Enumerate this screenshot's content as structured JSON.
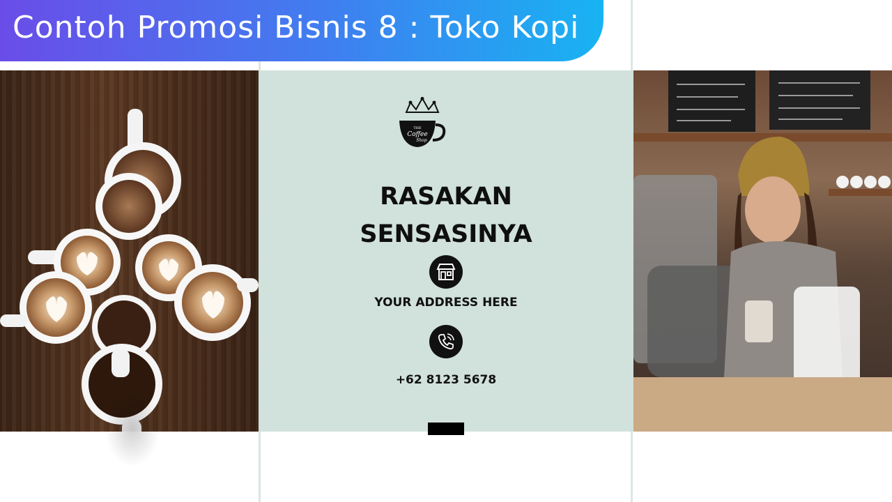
{
  "banner": {
    "title": "Contoh Promosi Bisnis 8 : Toko Kopi"
  },
  "logo": {
    "line1": "THE",
    "line2": "Coffee",
    "line3": "Shop"
  },
  "promo": {
    "headline_line1": "RASAKAN",
    "headline_line2": "SENSASINYA",
    "address": "YOUR ADDRESS HERE",
    "phone": "+62 8123 5678"
  },
  "icons": {
    "address_icon": "store-icon",
    "phone_icon": "phone-icon",
    "logo_icon": "coffee-crown-logo-icon"
  },
  "colors": {
    "banner_start": "#6a4de8",
    "banner_end": "#18b3f2",
    "panel_bg": "#d1e1db",
    "text": "#0f0f0f"
  }
}
